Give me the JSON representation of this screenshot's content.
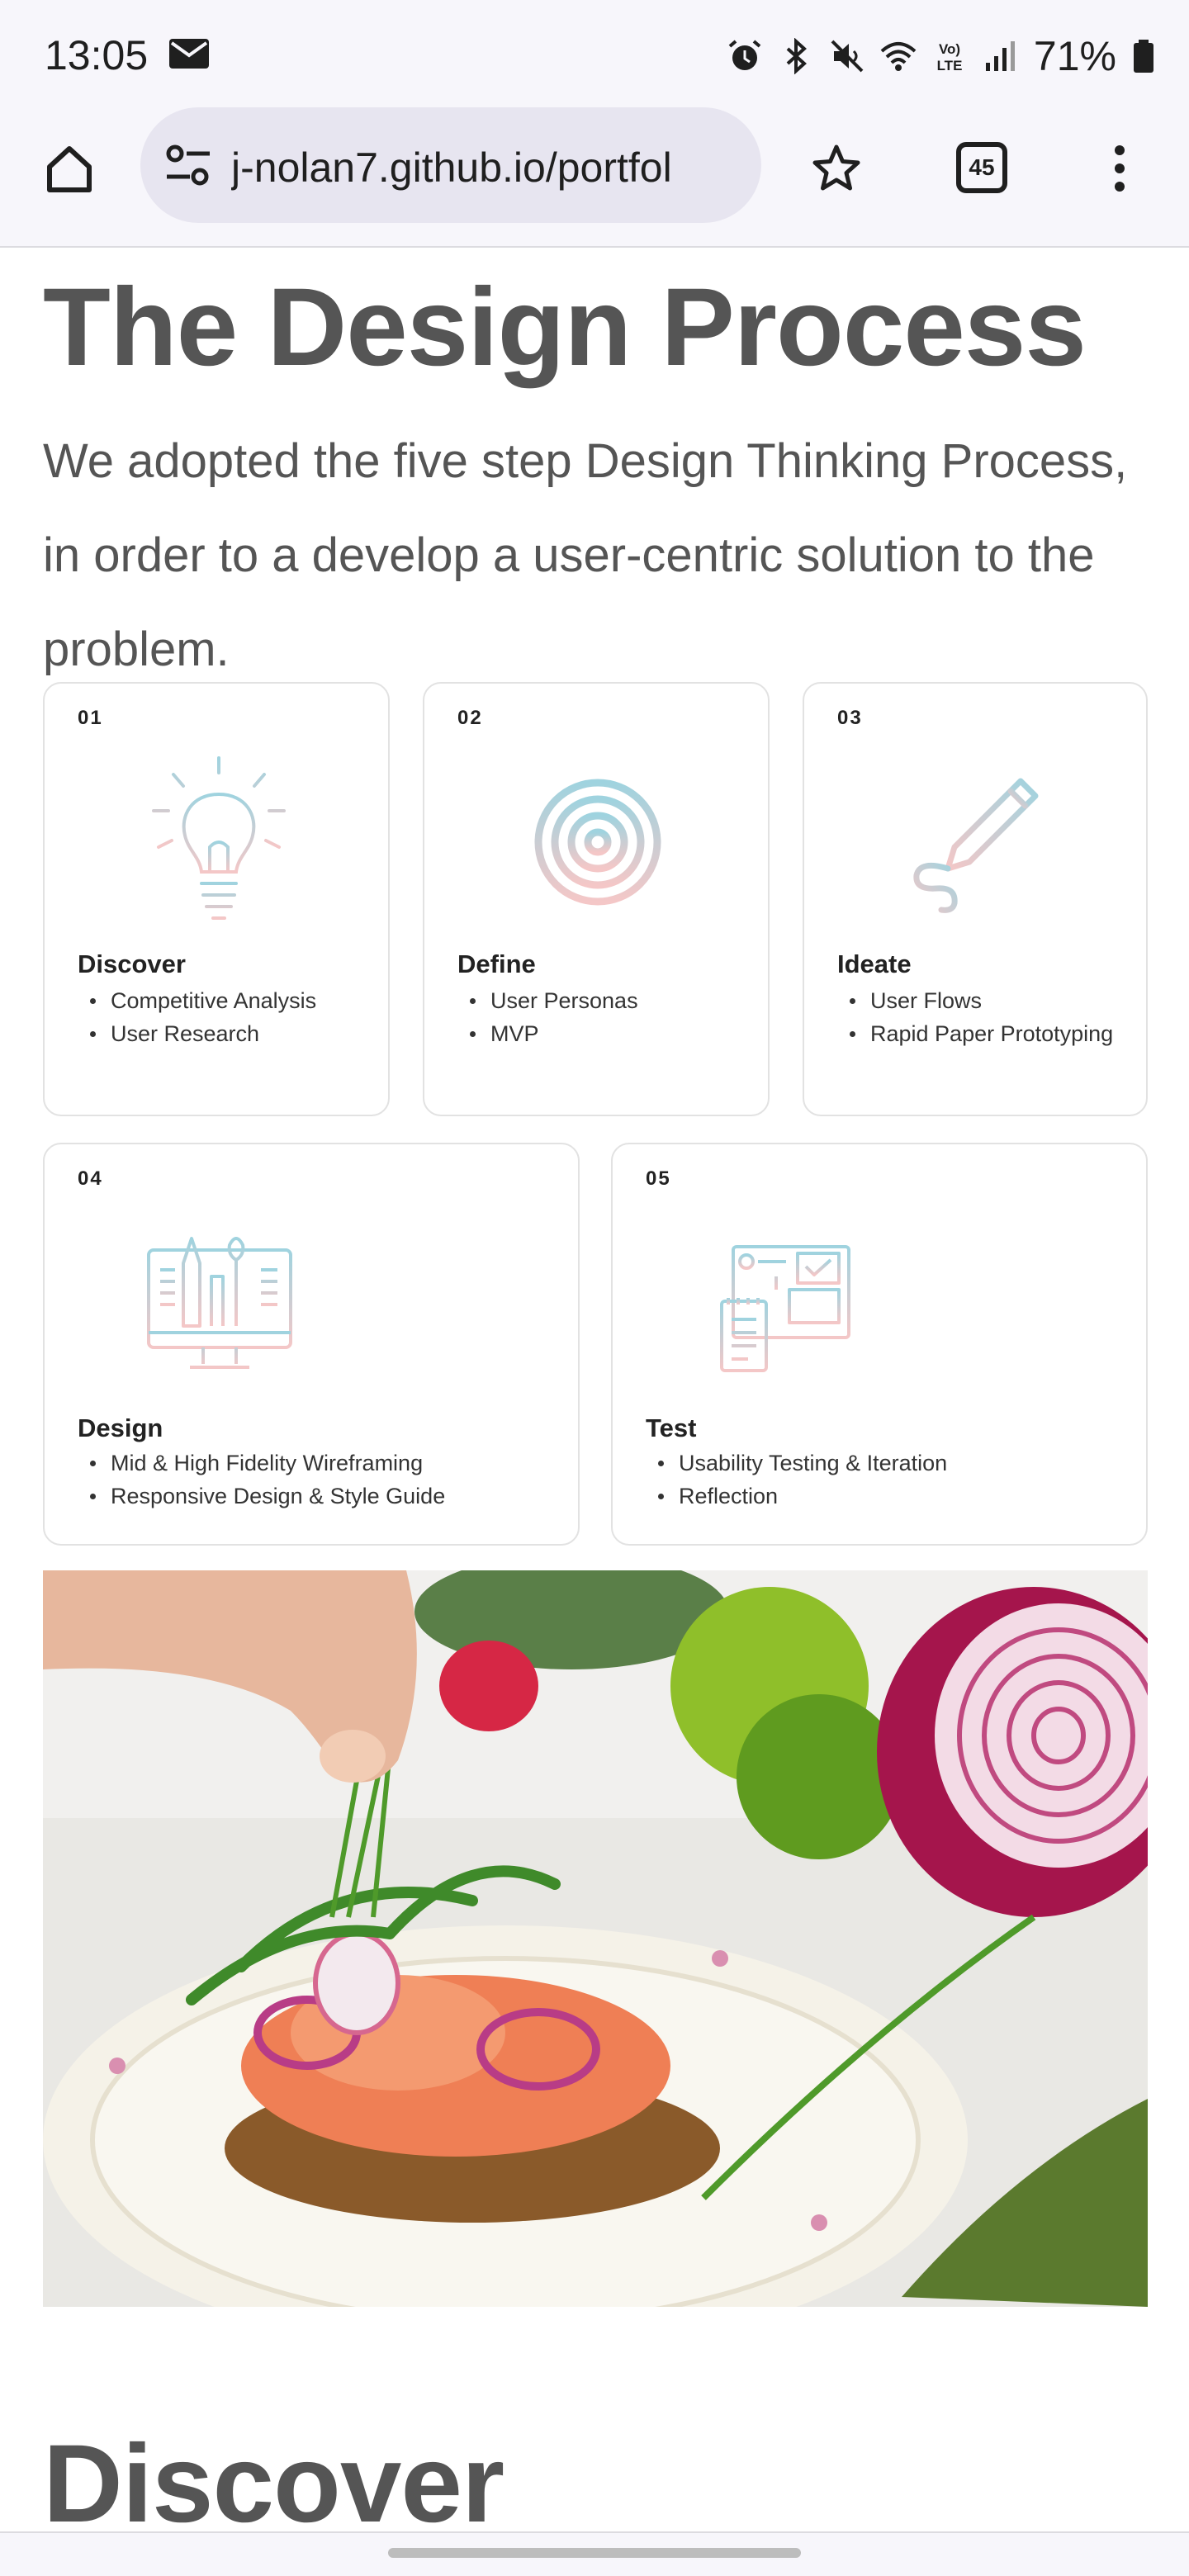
{
  "status_bar": {
    "time": "13:05",
    "battery": "71%",
    "icons": [
      "mail-icon",
      "alarm-icon",
      "bluetooth-icon",
      "mute-icon",
      "wifi-icon",
      "volte-icon",
      "signal-icon",
      "battery-icon"
    ]
  },
  "browser": {
    "url": "j-nolan7.github.io/portfol",
    "tab_count": "45",
    "icons": [
      "home-icon",
      "site-settings-icon",
      "bookmark-star-icon",
      "tabs-icon",
      "more-menu-icon"
    ]
  },
  "page": {
    "title": "The Design Process",
    "intro": "We adopted the five step Design Thinking Process, in order to a develop a user-centric solution to the problem.",
    "steps": [
      {
        "num": "01",
        "title": "Discover",
        "items": [
          "Competitive Analysis",
          "User Research"
        ],
        "icon": "lightbulb-icon"
      },
      {
        "num": "02",
        "title": "Define",
        "items": [
          "User Personas",
          "MVP"
        ],
        "icon": "target-icon"
      },
      {
        "num": "03",
        "title": "Ideate",
        "items": [
          "User Flows",
          "Rapid Paper Prototyping"
        ],
        "icon": "pen-icon"
      },
      {
        "num": "04",
        "title": "Design",
        "items": [
          "Mid & High Fidelity Wireframing",
          "Responsive Design & Style Guide"
        ],
        "icon": "design-monitor-icon"
      },
      {
        "num": "05",
        "title": "Test",
        "items": [
          "Usability Testing & Iteration",
          "Reflection"
        ],
        "icon": "wireframe-test-icon"
      }
    ],
    "section_title": "Discover"
  },
  "colors": {
    "heading": "#555555",
    "icon_blue": "#9fd3df",
    "icon_pink": "#f4c7c7"
  }
}
